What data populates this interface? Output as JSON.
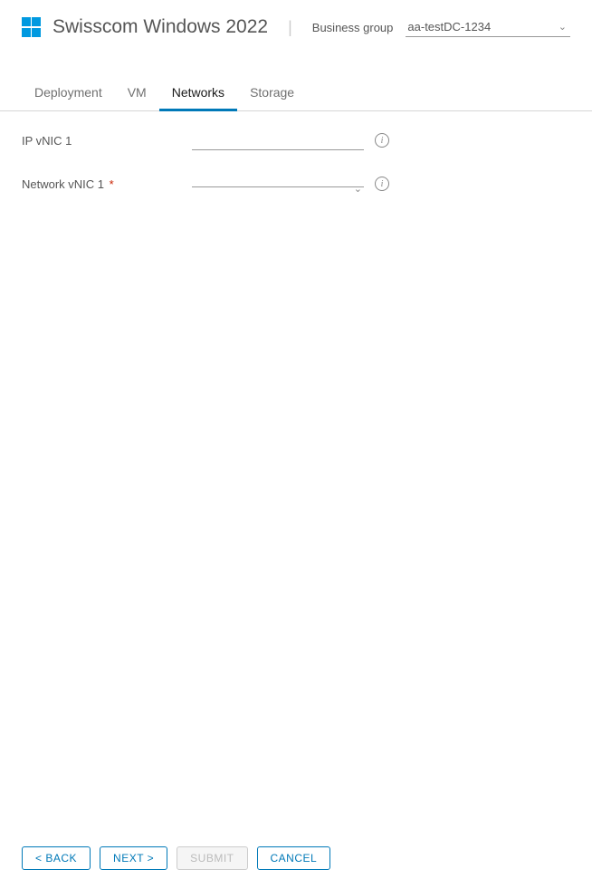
{
  "header": {
    "title": "Swisscom Windows 2022",
    "business_group_label": "Business group",
    "business_group_value": "aa-testDC-1234"
  },
  "tabs": [
    {
      "id": "deployment",
      "label": "Deployment",
      "active": false
    },
    {
      "id": "vm",
      "label": "VM",
      "active": false
    },
    {
      "id": "networks",
      "label": "Networks",
      "active": true
    },
    {
      "id": "storage",
      "label": "Storage",
      "active": false
    }
  ],
  "form": {
    "ip_vnic1": {
      "label": "IP vNIC 1",
      "value": ""
    },
    "network_vnic1": {
      "label": "Network vNIC 1",
      "value": "",
      "required": true
    }
  },
  "footer": {
    "back": "< BACK",
    "next": "NEXT >",
    "submit": "SUBMIT",
    "cancel": "CANCEL"
  }
}
